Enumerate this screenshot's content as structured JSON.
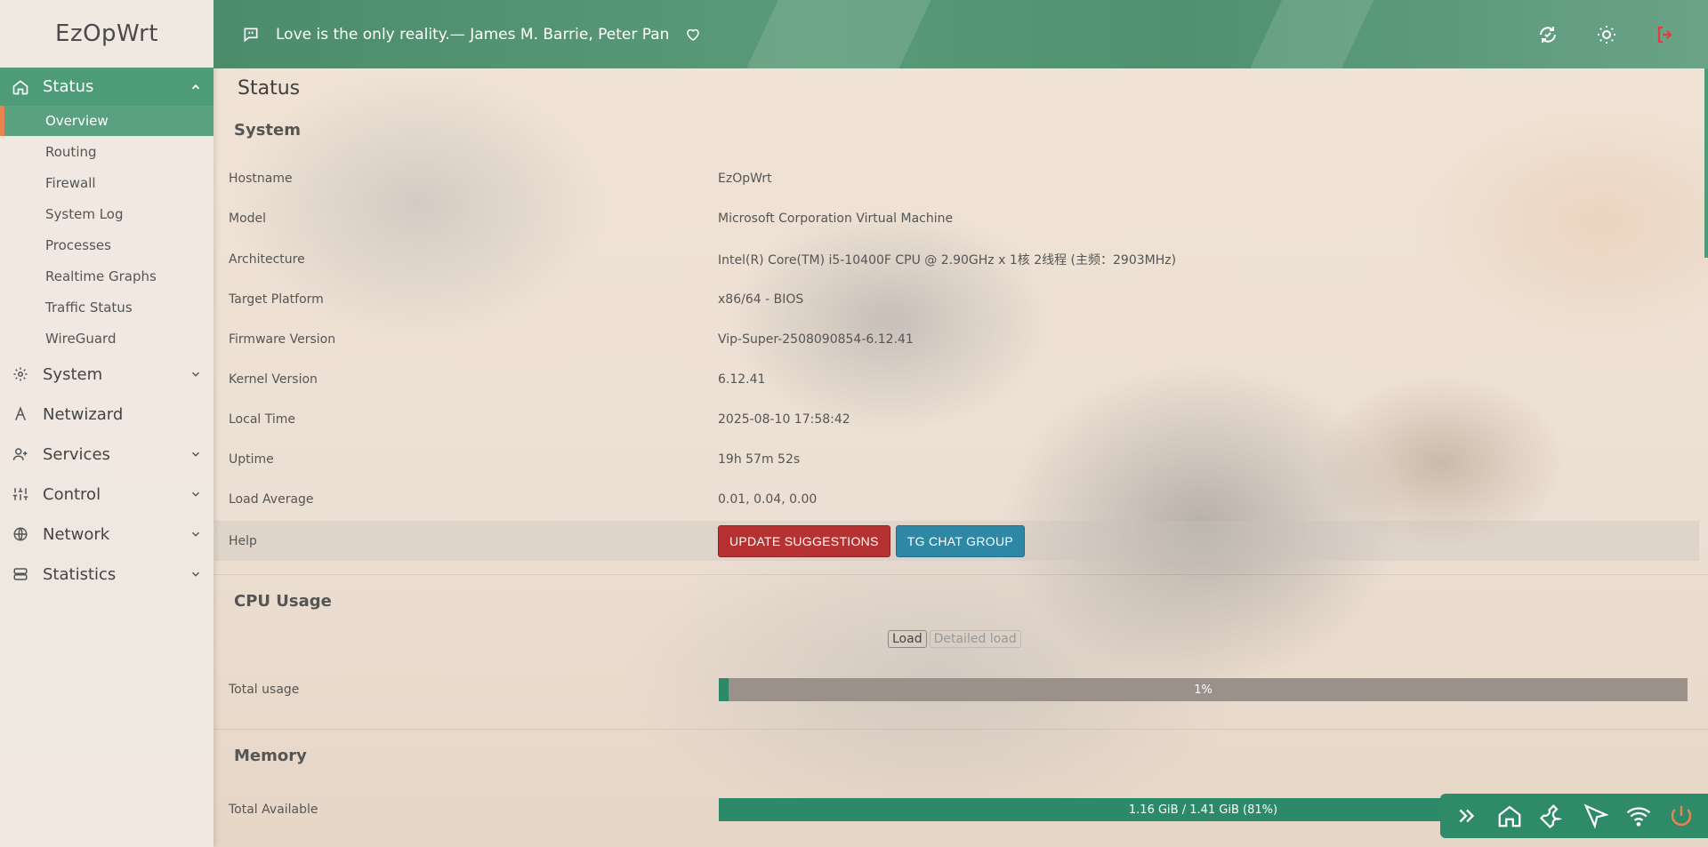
{
  "brand": "EzOpWrt",
  "header": {
    "quote": "Love is the only reality.— James M. Barrie, Peter Pan",
    "icons": [
      "message-icon",
      "heart-icon",
      "refresh-icon",
      "theme-sun-icon",
      "logout-icon"
    ]
  },
  "sidebar": {
    "status": {
      "label": "Status",
      "items": [
        "Overview",
        "Routing",
        "Firewall",
        "System Log",
        "Processes",
        "Realtime Graphs",
        "Traffic Status",
        "WireGuard"
      ]
    },
    "groups": [
      "System",
      "Netwizard",
      "Services",
      "Control",
      "Network",
      "Statistics"
    ]
  },
  "page": {
    "title": "Status"
  },
  "system": {
    "title": "System",
    "rows": [
      {
        "k": "Hostname",
        "v": "EzOpWrt"
      },
      {
        "k": "Model",
        "v": "Microsoft Corporation Virtual Machine"
      },
      {
        "k": "Architecture",
        "v": "Intel(R) Core(TM) i5-10400F CPU @ 2.90GHz x 1核 2线程 (主频：2903MHz)"
      },
      {
        "k": "Target Platform",
        "v": "x86/64 - BIOS"
      },
      {
        "k": "Firmware Version",
        "v": "Vip-Super-2508090854-6.12.41"
      },
      {
        "k": "Kernel Version",
        "v": "6.12.41"
      },
      {
        "k": "Local Time",
        "v": "2025-08-10 17:58:42"
      },
      {
        "k": "Uptime",
        "v": "19h 57m 52s"
      },
      {
        "k": "Load Average",
        "v": "0.01, 0.04, 0.00"
      }
    ],
    "help_label": "Help",
    "update_btn": "UPDATE SUGGESTIONS",
    "tg_btn": "TG CHAT GROUP"
  },
  "cpu": {
    "title": "CPU Usage",
    "tab_load": "Load",
    "tab_detailed": "Detailed load",
    "total_label": "Total usage",
    "total_text": "1%",
    "total_fraction": 0.01
  },
  "memory": {
    "title": "Memory",
    "available_label": "Total Available",
    "available_text": "1.16 GiB / 1.41 GiB (81%)",
    "available_fraction": 0.81
  },
  "colors": {
    "accent": "#4e9b78",
    "accent_dark": "#2c8a68",
    "active_marker": "#e9834f",
    "btn_red": "#b63131",
    "btn_blue": "#2d87a5"
  },
  "dock": {
    "icons": [
      "double-chevron-right-icon",
      "home-icon",
      "wrench-icon",
      "send-icon",
      "wifi-icon",
      "power-icon"
    ]
  }
}
